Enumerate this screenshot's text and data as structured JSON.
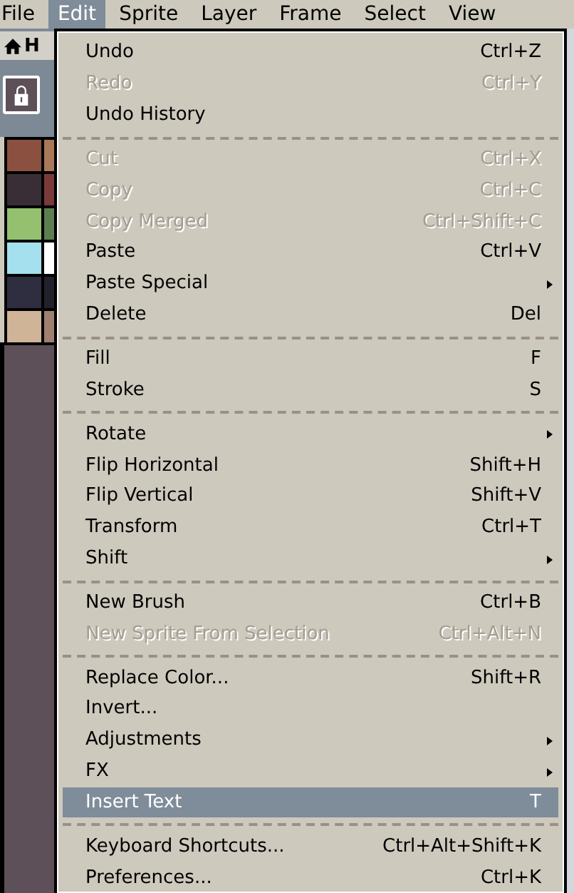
{
  "menu_bar": [
    {
      "label": "File",
      "selected": false
    },
    {
      "label": "Edit",
      "selected": true
    },
    {
      "label": "Sprite",
      "selected": false
    },
    {
      "label": "Layer",
      "selected": false
    },
    {
      "label": "Frame",
      "selected": false
    },
    {
      "label": "Select",
      "selected": false
    },
    {
      "label": "View",
      "selected": false
    }
  ],
  "tab": {
    "label": "H"
  },
  "palette": [
    {
      "color": "#8c5040"
    },
    {
      "color": "#a87858"
    },
    {
      "color": "#3a2e36"
    },
    {
      "color": "#7a3a3a"
    },
    {
      "color": "#94c070"
    },
    {
      "color": "#5e7e52"
    },
    {
      "color": "#a4e0ee"
    },
    {
      "color": "#ffffff"
    },
    {
      "color": "#2e2e40"
    },
    {
      "color": "#22202a"
    },
    {
      "color": "#d0b498"
    },
    {
      "color": "#a08070"
    }
  ],
  "edit_menu": [
    {
      "kind": "item",
      "label": "Undo",
      "shortcut": "Ctrl+Z",
      "disabled": false,
      "submenu": false,
      "selected": false
    },
    {
      "kind": "item",
      "label": "Redo",
      "shortcut": "Ctrl+Y",
      "disabled": true,
      "submenu": false,
      "selected": false
    },
    {
      "kind": "item",
      "label": "Undo History",
      "disabled": false,
      "submenu": false,
      "selected": false
    },
    {
      "kind": "separator"
    },
    {
      "kind": "item",
      "label": "Cut",
      "shortcut": "Ctrl+X",
      "disabled": true,
      "submenu": false,
      "selected": false
    },
    {
      "kind": "item",
      "label": "Copy",
      "shortcut": "Ctrl+C",
      "disabled": true,
      "submenu": false,
      "selected": false
    },
    {
      "kind": "item",
      "label": "Copy Merged",
      "shortcut": "Ctrl+Shift+C",
      "disabled": true,
      "submenu": false,
      "selected": false
    },
    {
      "kind": "item",
      "label": "Paste",
      "shortcut": "Ctrl+V",
      "disabled": false,
      "submenu": false,
      "selected": false
    },
    {
      "kind": "item",
      "label": "Paste Special",
      "disabled": false,
      "submenu": true,
      "selected": false
    },
    {
      "kind": "item",
      "label": "Delete",
      "shortcut": "Del",
      "disabled": false,
      "submenu": false,
      "selected": false
    },
    {
      "kind": "separator"
    },
    {
      "kind": "item",
      "label": "Fill",
      "shortcut": "F",
      "disabled": false,
      "submenu": false,
      "selected": false
    },
    {
      "kind": "item",
      "label": "Stroke",
      "shortcut": "S",
      "disabled": false,
      "submenu": false,
      "selected": false
    },
    {
      "kind": "separator"
    },
    {
      "kind": "item",
      "label": "Rotate",
      "disabled": false,
      "submenu": true,
      "selected": false
    },
    {
      "kind": "item",
      "label": "Flip Horizontal",
      "shortcut": "Shift+H",
      "disabled": false,
      "submenu": false,
      "selected": false
    },
    {
      "kind": "item",
      "label": "Flip Vertical",
      "shortcut": "Shift+V",
      "disabled": false,
      "submenu": false,
      "selected": false
    },
    {
      "kind": "item",
      "label": "Transform",
      "shortcut": "Ctrl+T",
      "disabled": false,
      "submenu": false,
      "selected": false
    },
    {
      "kind": "item",
      "label": "Shift",
      "disabled": false,
      "submenu": true,
      "selected": false
    },
    {
      "kind": "separator"
    },
    {
      "kind": "item",
      "label": "New Brush",
      "shortcut": "Ctrl+B",
      "disabled": false,
      "submenu": false,
      "selected": false
    },
    {
      "kind": "item",
      "label": "New Sprite From Selection",
      "shortcut": "Ctrl+Alt+N",
      "disabled": true,
      "submenu": false,
      "selected": false
    },
    {
      "kind": "separator"
    },
    {
      "kind": "item",
      "label": "Replace Color...",
      "shortcut": "Shift+R",
      "disabled": false,
      "submenu": false,
      "selected": false
    },
    {
      "kind": "item",
      "label": "Invert...",
      "disabled": false,
      "submenu": false,
      "selected": false
    },
    {
      "kind": "item",
      "label": "Adjustments",
      "disabled": false,
      "submenu": true,
      "selected": false
    },
    {
      "kind": "item",
      "label": "FX",
      "disabled": false,
      "submenu": true,
      "selected": false
    },
    {
      "kind": "item",
      "label": "Insert Text",
      "shortcut": "T",
      "disabled": false,
      "submenu": false,
      "selected": true
    },
    {
      "kind": "separator"
    },
    {
      "kind": "item",
      "label": "Keyboard Shortcuts...",
      "shortcut": "Ctrl+Alt+Shift+K",
      "disabled": false,
      "submenu": false,
      "selected": false
    },
    {
      "kind": "item",
      "label": "Preferences...",
      "shortcut": "Ctrl+K",
      "disabled": false,
      "submenu": false,
      "selected": false
    }
  ]
}
